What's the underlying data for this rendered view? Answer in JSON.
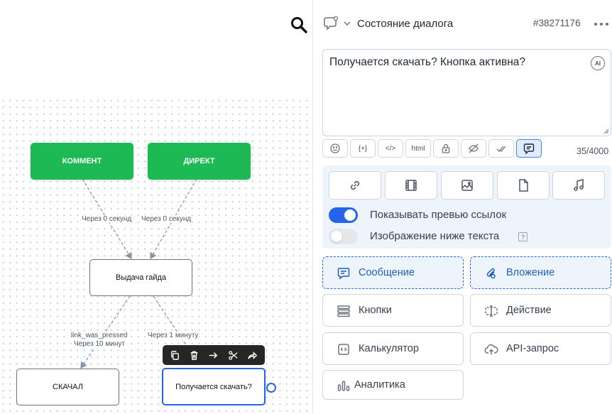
{
  "canvas": {
    "nodes": {
      "komment": "КОММЕНТ",
      "direkt": "ДИРЕКТ",
      "vydacha": "Выдача гайда",
      "skachal": "СКАЧАЛ",
      "poluchaetsya": "Получается скачать?"
    },
    "edge_labels": {
      "delay_left": "Через 0 секунд",
      "delay_right": "Через 0 секунд",
      "event_left": "link_was_pressed",
      "delay_left_2": "Через 10 минут",
      "delay_right_2": "Через 1 минуту"
    },
    "node_toolbar": [
      "copy-icon",
      "trash-icon",
      "arrow-right-icon",
      "scissors-icon",
      "share-icon"
    ],
    "colors": {
      "trigger": "#1db954",
      "selected": "#2563eb"
    }
  },
  "panel": {
    "header": {
      "title": "Состояние диалога",
      "id": "#38271176"
    },
    "editor": {
      "text": "Получается скачать? Кнопка активна?",
      "ai_badge": "AI",
      "char_count": "35/4000"
    },
    "format_buttons": [
      {
        "name": "emoji",
        "label": ""
      },
      {
        "name": "variables",
        "label": "{+}"
      },
      {
        "name": "code",
        "label": "</>"
      },
      {
        "name": "html",
        "label": "html"
      },
      {
        "name": "lock",
        "label": ""
      },
      {
        "name": "hide-preview",
        "label": ""
      },
      {
        "name": "double-check",
        "label": ""
      },
      {
        "name": "comment",
        "label": ""
      }
    ],
    "attachments": [
      "link-icon",
      "video-icon",
      "image-icon",
      "file-icon",
      "audio-icon"
    ],
    "toggles": {
      "preview_links": {
        "label": "Показывать превью ссылок",
        "on": true
      },
      "image_below": {
        "label": "Изображение ниже текста",
        "on": false,
        "help": "?"
      }
    },
    "blocks": {
      "message": "Сообщение",
      "attachment": "Вложение",
      "buttons": "Кнопки",
      "action": "Действие",
      "calculator": "Калькулятор",
      "api": "API-запрос",
      "analytics": "Аналитика"
    }
  }
}
